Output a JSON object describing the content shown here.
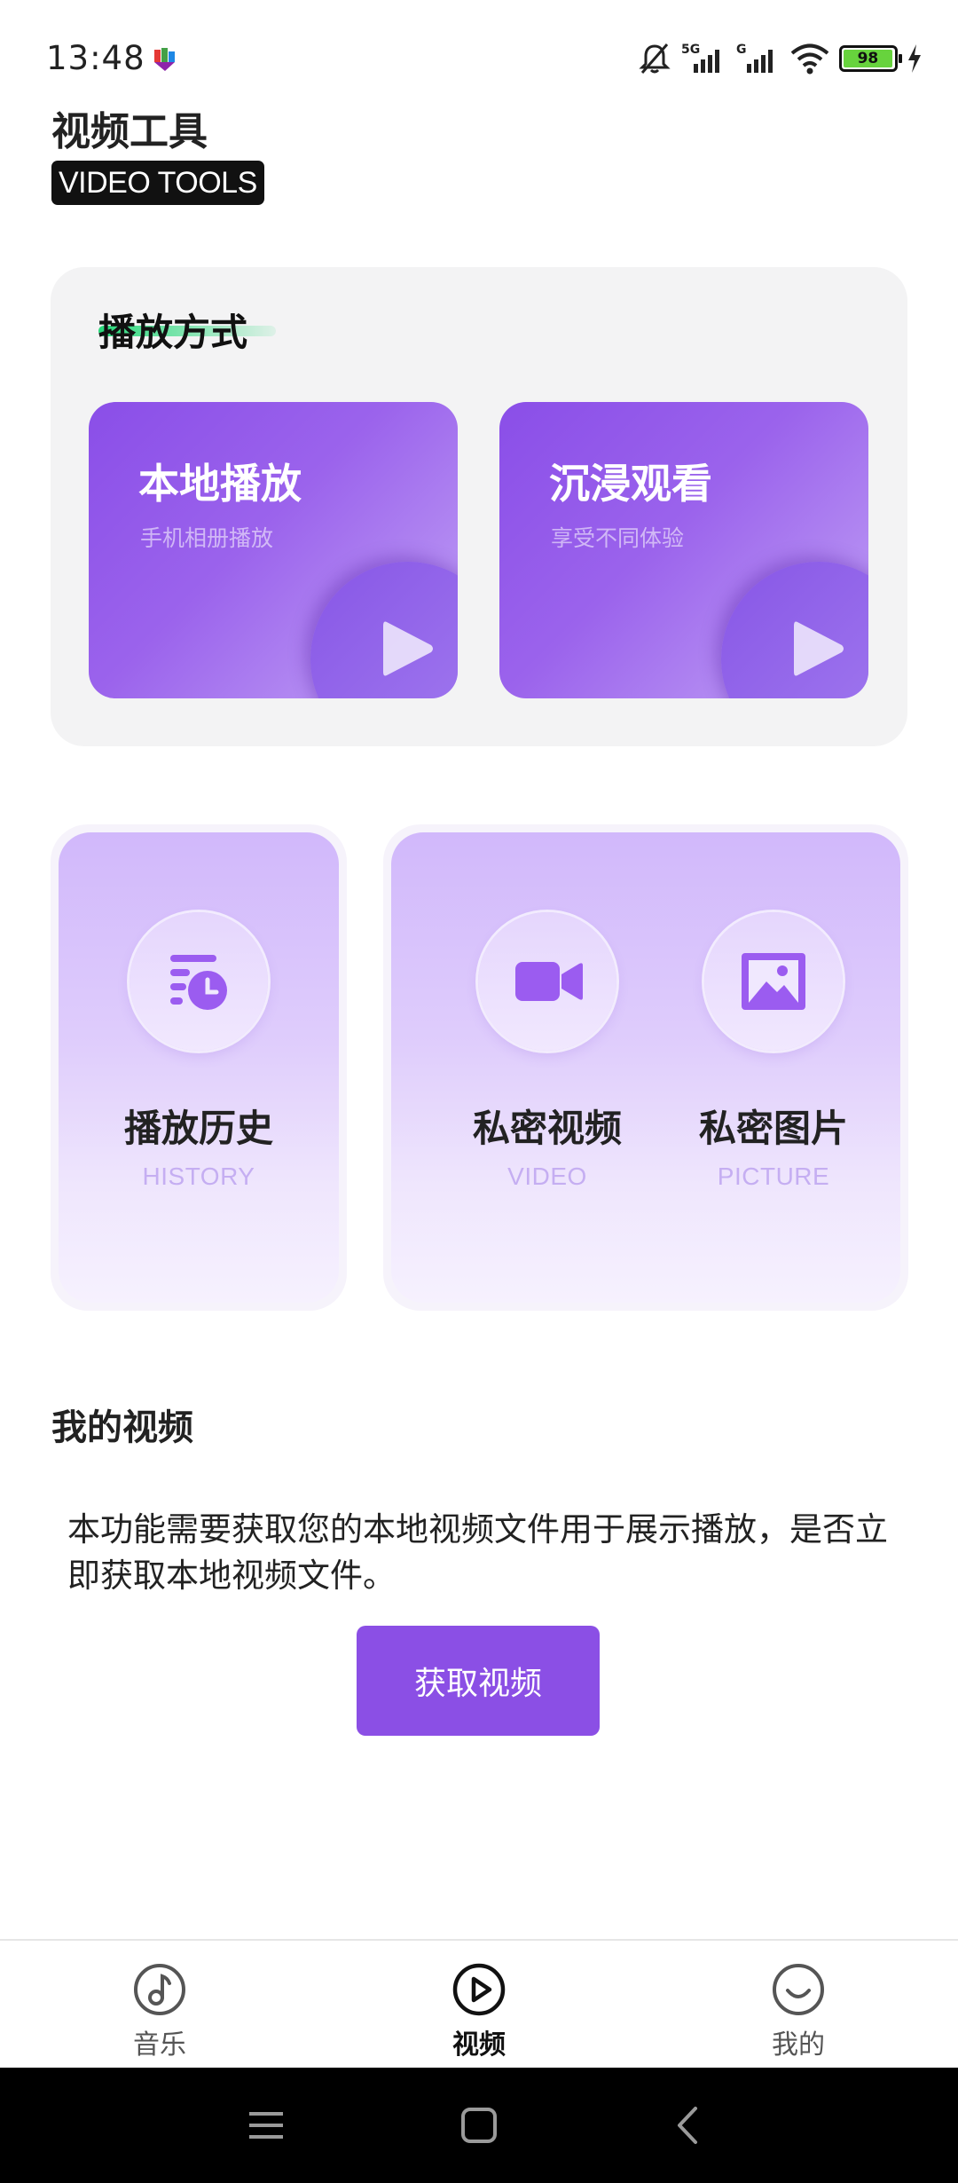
{
  "status_bar": {
    "time": "13:48",
    "battery_level": "98",
    "network_labels": [
      "5G",
      "G"
    ],
    "icons": [
      "notification-app-icon",
      "mute-bell-icon",
      "signal-icon",
      "signal-icon",
      "wifi-icon",
      "battery-icon",
      "charging-icon"
    ]
  },
  "header": {
    "title": "视频工具",
    "subtitle": "VIDEO TOOLS"
  },
  "play_modes": {
    "heading": "播放方式",
    "cards": [
      {
        "title": "本地播放",
        "subtitle": "手机相册播放",
        "icon": "play-icon"
      },
      {
        "title": "沉浸观看",
        "subtitle": "享受不同体验",
        "icon": "play-icon"
      }
    ]
  },
  "features": {
    "history": {
      "label": "播放历史",
      "en": "HISTORY",
      "icon": "history-list-clock-icon"
    },
    "private_video": {
      "label": "私密视频",
      "en": "VIDEO",
      "icon": "video-camera-icon"
    },
    "private_picture": {
      "label": "私密图片",
      "en": "PICTURE",
      "icon": "image-icon"
    }
  },
  "my_videos": {
    "title": "我的视频",
    "permission_text": "本功能需要获取您的本地视频文件用于展示播放，是否立即获取本地视频文件。",
    "button_label": "获取视频"
  },
  "bottom_nav": {
    "items": [
      {
        "label": "音乐",
        "icon": "music-note-icon",
        "active": false
      },
      {
        "label": "视频",
        "icon": "play-circle-icon",
        "active": true
      },
      {
        "label": "我的",
        "icon": "smiley-face-icon",
        "active": false
      }
    ]
  },
  "system_nav": {
    "icons": [
      "menu-icon",
      "home-icon",
      "back-icon"
    ]
  },
  "colors": {
    "accent": "#8b4fe5",
    "card_gradient_start": "#8a4ee8",
    "card_gradient_end": "#c3a5f6",
    "feature_gradient_top": "#d1b8fb",
    "feature_text_light": "#c5aef2",
    "heading_highlight": "#27d97a",
    "battery_green": "#67d33d"
  }
}
